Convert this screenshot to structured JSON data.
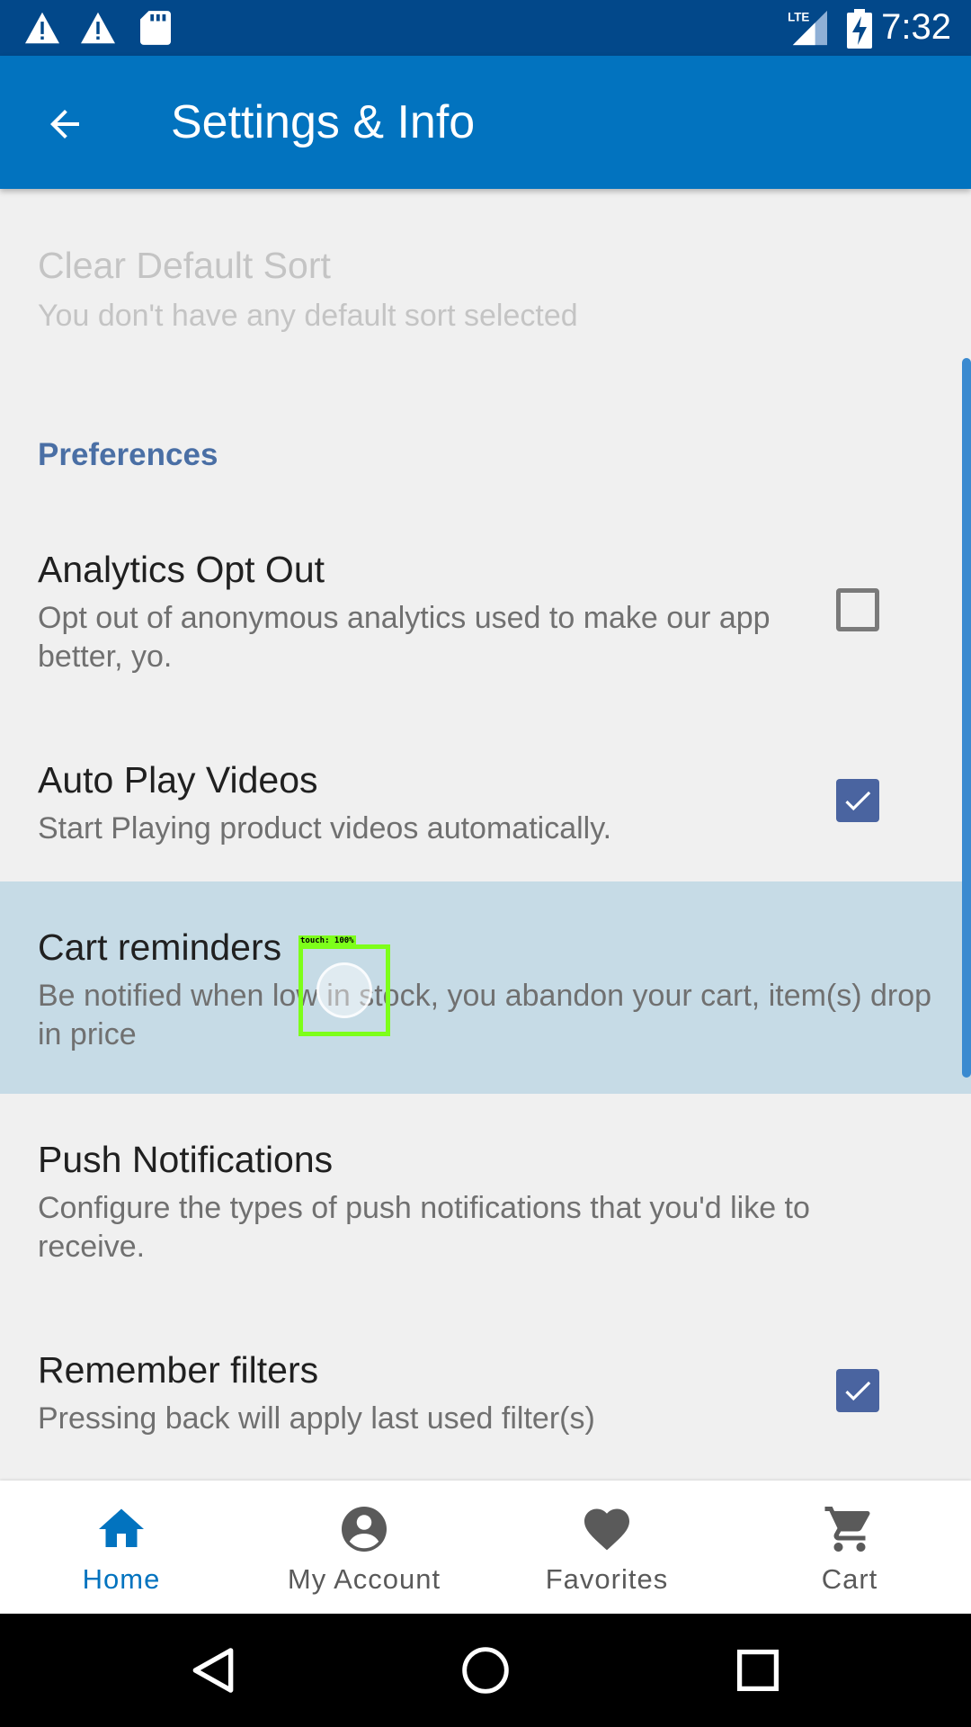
{
  "status_bar": {
    "time": "7:32",
    "left_icons": [
      "warning-icon",
      "warning-icon",
      "sd-card-icon"
    ],
    "right_icons": [
      "lte-signal-icon",
      "battery-charging-icon"
    ],
    "network_label": "LTE"
  },
  "app_bar": {
    "title": "Settings & Info",
    "back_icon": "arrow-back-icon"
  },
  "preferences": {
    "clear_default_sort": {
      "title": "Clear Default Sort",
      "summary": "You don't have any default sort selected",
      "enabled": false
    },
    "category_label": "Preferences",
    "analytics": {
      "title": "Analytics Opt Out",
      "summary": "Opt out of anonymous analytics used to make our app better, yo.",
      "checked": false
    },
    "auto_play": {
      "title": "Auto Play Videos",
      "summary": "Start Playing product videos automatically.",
      "checked": true
    },
    "cart_reminders": {
      "title": "Cart reminders",
      "summary": "Be notified when low in stock, you abandon your cart, item(s) drop in price"
    },
    "push_notifications": {
      "title": "Push Notifications",
      "summary": "Configure the types of push notifications that you'd like to receive."
    },
    "remember_filters": {
      "title": "Remember filters",
      "summary": "Pressing back will apply last used filter(s)",
      "checked": true
    }
  },
  "touch_overlay": {
    "label": "touch: 100%"
  },
  "bottom_nav": {
    "items": [
      {
        "label": "Home",
        "icon": "home-icon",
        "active": true
      },
      {
        "label": "My Account",
        "icon": "account-icon",
        "active": false
      },
      {
        "label": "Favorites",
        "icon": "heart-icon",
        "active": false
      },
      {
        "label": "Cart",
        "icon": "cart-icon",
        "active": false
      }
    ]
  },
  "system_nav": {
    "buttons": [
      "back-triangle-icon",
      "home-circle-icon",
      "recents-square-icon"
    ]
  },
  "colors": {
    "status_bar": "#02488a",
    "app_bar": "#0273bf",
    "accent": "#4a64a0",
    "highlight": "#c6dbe6",
    "active_nav": "#0273bf"
  }
}
